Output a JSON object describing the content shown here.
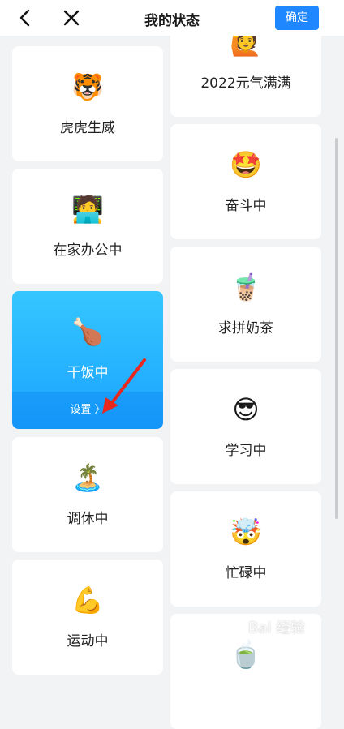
{
  "header": {
    "title": "我的状态",
    "confirm_label": "确定"
  },
  "left_column": [
    {
      "emoji": "🐯",
      "label": "虎虎生威"
    },
    {
      "emoji": "🧑‍💻",
      "label": "在家办公中"
    },
    {
      "emoji": "🍗",
      "label": "干饭中",
      "settings": "设置 〉",
      "selected": true
    },
    {
      "emoji": "🏝️",
      "label": "调休中"
    },
    {
      "emoji": "💪",
      "label": "运动中"
    }
  ],
  "right_column": [
    {
      "emoji": "🙋",
      "label": "2022元气满满"
    },
    {
      "emoji": "🤩",
      "label": "奋斗中"
    },
    {
      "emoji": "🧋",
      "label": "求拼奶茶"
    },
    {
      "emoji": "😎",
      "label": "学习中"
    },
    {
      "emoji": "🤯",
      "label": "忙碌中"
    },
    {
      "emoji": "🍵",
      "label": ""
    }
  ],
  "watermark": "Bai 经验"
}
